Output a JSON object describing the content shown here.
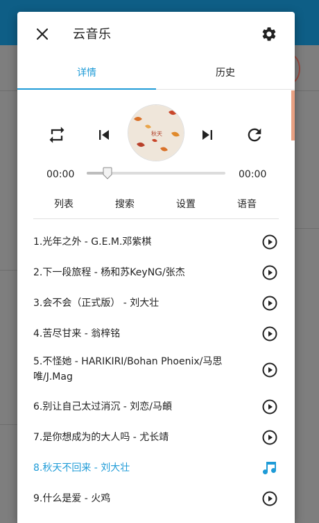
{
  "dialog": {
    "title": "云音乐",
    "close_icon": "close-icon",
    "settings_icon": "gear-icon"
  },
  "tabs": [
    {
      "label": "详情",
      "active": true
    },
    {
      "label": "历史",
      "active": false
    }
  ],
  "player": {
    "current_time": "00:00",
    "total_time": "00:00",
    "progress": 0.15,
    "controls": [
      "repeat-icon",
      "previous-icon",
      "album-art",
      "next-icon",
      "refresh-icon"
    ]
  },
  "menu": [
    {
      "label": "列表"
    },
    {
      "label": "搜索"
    },
    {
      "label": "设置"
    },
    {
      "label": "语音"
    }
  ],
  "songs": [
    {
      "title": "1.光年之外 - G.E.M.邓紫棋",
      "active": false
    },
    {
      "title": "2.下一段旅程 - 杨和苏KeyNG/张杰",
      "active": false
    },
    {
      "title": "3.会不会（正式版） - 刘大壮",
      "active": false
    },
    {
      "title": "4.苦尽甘来 - 翁梓铭",
      "active": false
    },
    {
      "title": "5.不怪她 - HARIKIRI/Bohan Phoenix/马思唯/J.Mag",
      "active": false
    },
    {
      "title": "6.别让自己太过消沉 - 刘恋/马頔",
      "active": false
    },
    {
      "title": "7.是你想成为的大人吗 - 尤长靖",
      "active": false
    },
    {
      "title": "8.秋天不回来 - 刘大壮",
      "active": true
    },
    {
      "title": "9.什么是爱 - 火鸡",
      "active": false
    }
  ],
  "colors": {
    "accent": "#1e9bd7",
    "header": "#0e5e86",
    "scroll_thumb": "#e8a082"
  }
}
